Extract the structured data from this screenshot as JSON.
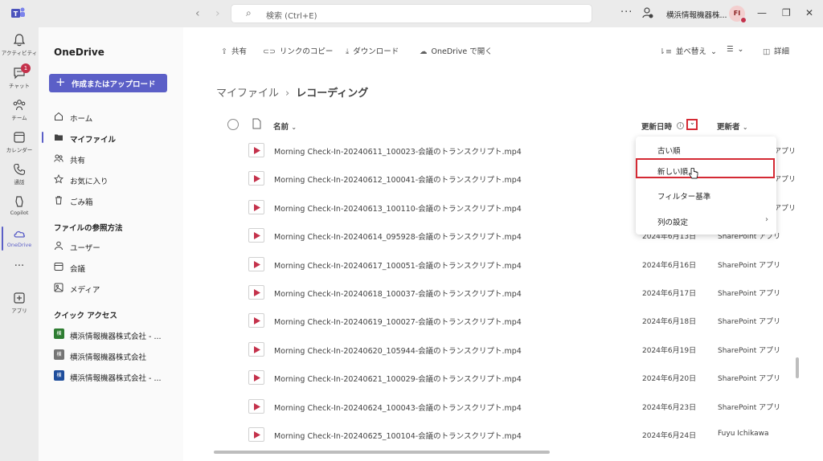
{
  "titlebar": {
    "search_placeholder": "検索 (Ctrl+E)",
    "org_name": "横浜情報機器株...",
    "avatar_initials": "FI"
  },
  "rail": {
    "items": [
      {
        "label": "アクティビティ",
        "icon": "bell-icon"
      },
      {
        "label": "チャット",
        "icon": "chat-icon",
        "badge": "1"
      },
      {
        "label": "チーム",
        "icon": "teams-icon"
      },
      {
        "label": "カレンダー",
        "icon": "calendar-icon"
      },
      {
        "label": "通話",
        "icon": "phone-icon"
      },
      {
        "label": "Copilot",
        "icon": "copilot-icon"
      },
      {
        "label": "OneDrive",
        "icon": "cloud-icon"
      },
      {
        "label": "アプリ",
        "icon": "add-app-icon"
      }
    ]
  },
  "leftpane": {
    "title": "OneDrive",
    "create_label": "作成またはアップロード",
    "nav": [
      {
        "label": "ホーム",
        "icon": "home-icon"
      },
      {
        "label": "マイファイル",
        "icon": "folder-icon"
      },
      {
        "label": "共有",
        "icon": "people-icon"
      },
      {
        "label": "お気に入り",
        "icon": "star-icon"
      },
      {
        "label": "ごみ箱",
        "icon": "trash-icon"
      }
    ],
    "browse_section": "ファイルの参照方法",
    "browse": [
      {
        "label": "ユーザー",
        "icon": "person-icon"
      },
      {
        "label": "会議",
        "icon": "meeting-icon"
      },
      {
        "label": "メディア",
        "icon": "image-icon"
      }
    ],
    "quick_section": "クイック アクセス",
    "quick": [
      {
        "label": "横浜情報機器株式会社 - ...",
        "badge": "横",
        "color": "#2e7d32"
      },
      {
        "label": "横浜情報機器株式会社",
        "badge": "横",
        "color": "#757575"
      },
      {
        "label": "横浜情報機器株式会社 - ...",
        "badge": "横",
        "color": "#1f4e9c"
      }
    ]
  },
  "toolbar": {
    "share": "共有",
    "copy_link": "リンクのコピー",
    "download": "ダウンロード",
    "open_in": "OneDrive で開く",
    "sort": "並べ替え",
    "details": "詳細"
  },
  "breadcrumb": {
    "root": "マイファイル",
    "current": "レコーディング"
  },
  "columns": {
    "name": "名前",
    "modified": "更新日時",
    "modified_by": "更新者"
  },
  "files": [
    {
      "name": "Morning Check-In-20240611_100023-会議のトランスクリプト.mp4",
      "date": "",
      "by": "アプリ"
    },
    {
      "name": "Morning Check-In-20240612_100041-会議のトランスクリプト.mp4",
      "date": "",
      "by": "アプリ"
    },
    {
      "name": "Morning Check-In-20240613_100110-会議のトランスクリプト.mp4",
      "date": "",
      "by": "アプリ"
    },
    {
      "name": "Morning Check-In-20240614_095928-会議のトランスクリプト.mp4",
      "date": "2024年6月13日",
      "by": "SharePoint アプリ"
    },
    {
      "name": "Morning Check-In-20240617_100051-会議のトランスクリプト.mp4",
      "date": "2024年6月16日",
      "by": "SharePoint アプリ"
    },
    {
      "name": "Morning Check-In-20240618_100037-会議のトランスクリプト.mp4",
      "date": "2024年6月17日",
      "by": "SharePoint アプリ"
    },
    {
      "name": "Morning Check-In-20240619_100027-会議のトランスクリプト.mp4",
      "date": "2024年6月18日",
      "by": "SharePoint アプリ"
    },
    {
      "name": "Morning Check-In-20240620_105944-会議のトランスクリプト.mp4",
      "date": "2024年6月19日",
      "by": "SharePoint アプリ"
    },
    {
      "name": "Morning Check-In-20240621_100029-会議のトランスクリプト.mp4",
      "date": "2024年6月20日",
      "by": "SharePoint アプリ"
    },
    {
      "name": "Morning Check-In-20240624_100043-会議のトランスクリプト.mp4",
      "date": "2024年6月23日",
      "by": "SharePoint アプリ"
    },
    {
      "name": "Morning Check-In-20240625_100104-会議のトランスクリプト.mp4",
      "date": "2024年6月24日",
      "by": "Fuyu Ichikawa"
    }
  ],
  "sort_menu": {
    "items": [
      "古い順",
      "新しい順",
      "フィルター基準",
      "列の設定"
    ]
  },
  "colors": {
    "accent": "#5b5fc7",
    "highlight": "#d42a34",
    "video_icon": "#c4314b"
  }
}
